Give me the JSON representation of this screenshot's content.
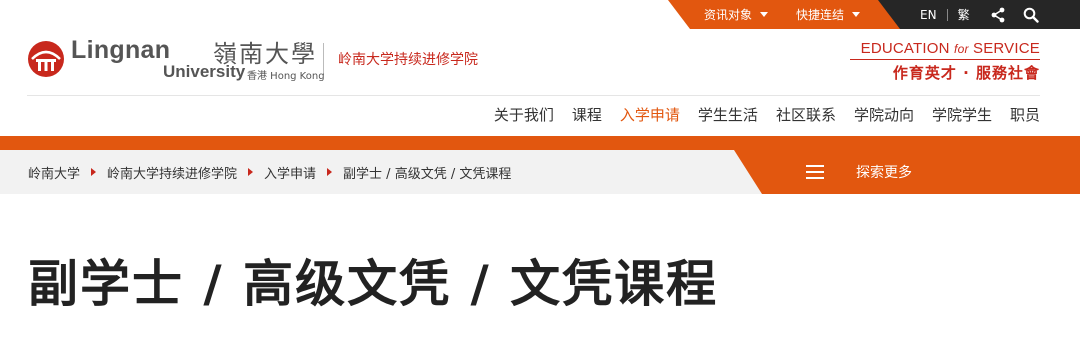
{
  "top_bar": {
    "audience_label": "资讯对象",
    "quick_links_label": "快捷连结",
    "lang_en": "EN",
    "lang_trad": "繁",
    "share_icon": "share-icon",
    "search_icon": "search-icon"
  },
  "logo": {
    "name_en": "Lingnan",
    "name_zh": "嶺南大學",
    "univ": "University",
    "location": "香港 Hong Kong",
    "school": "岭南大学持续进修学院"
  },
  "tagline": {
    "en_part1": "EDUCATION",
    "en_for": "for",
    "en_part2": "SERVICE",
    "zh": "作育英才 · 服務社會"
  },
  "main_nav": {
    "items": [
      {
        "label": "关于我们"
      },
      {
        "label": "课程"
      },
      {
        "label": "入学申请",
        "active": true
      },
      {
        "label": "学生生活"
      },
      {
        "label": "社区联系"
      },
      {
        "label": "学院动向"
      },
      {
        "label": "学院学生"
      },
      {
        "label": "职员"
      }
    ]
  },
  "breadcrumb": {
    "items": [
      "岭南大学",
      "岭南大学持续进修学院",
      "入学申请",
      "副学士 / 高级文凭 / 文凭课程"
    ]
  },
  "explore": {
    "label": "探索更多",
    "icon": "menu-icon"
  },
  "page": {
    "title": "副学士 / 高级文凭 / 文凭课程"
  },
  "colors": {
    "accent_orange": "#e2570f",
    "brand_red": "#c8281d",
    "dark_bar": "#262626",
    "crumb_bg": "#f2f2f2"
  }
}
